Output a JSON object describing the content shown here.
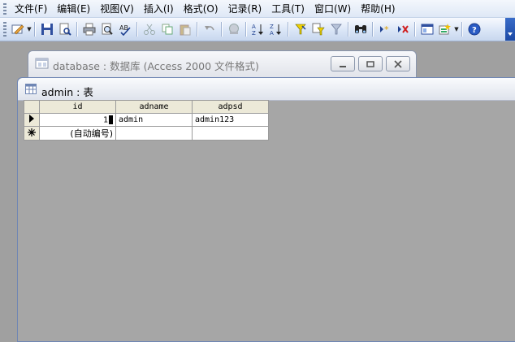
{
  "menubar": {
    "items": [
      "文件(F)",
      "编辑(E)",
      "视图(V)",
      "插入(I)",
      "格式(O)",
      "记录(R)",
      "工具(T)",
      "窗口(W)",
      "帮助(H)"
    ]
  },
  "toolbar": {
    "icons": [
      "design-view-icon",
      "save-icon",
      "file-search-icon",
      "print-icon",
      "print-preview-icon",
      "spelling-icon",
      "cut-icon",
      "copy-icon",
      "paste-icon",
      "undo-icon",
      "hyperlink-icon",
      "sort-ascending-icon",
      "sort-descending-icon",
      "filter-by-selection-icon",
      "filter-by-form-icon",
      "apply-filter-icon",
      "find-icon",
      "new-record-icon",
      "delete-record-icon",
      "database-window-icon",
      "new-object-icon",
      "help-icon"
    ]
  },
  "db_window": {
    "title": "database : 数据库 (Access 2000 文件格式)"
  },
  "table_window": {
    "title": "admin : 表",
    "columns": [
      "id",
      "adname",
      "adpsd"
    ],
    "rows": [
      {
        "id": "1",
        "adname": "admin",
        "adpsd": "admin123"
      }
    ],
    "new_row_id": "(自动编号)"
  },
  "colors": {
    "workspace": "#a0a0a0",
    "menubar": "#dfe8f6",
    "toolbar": "#c8d7ee"
  }
}
